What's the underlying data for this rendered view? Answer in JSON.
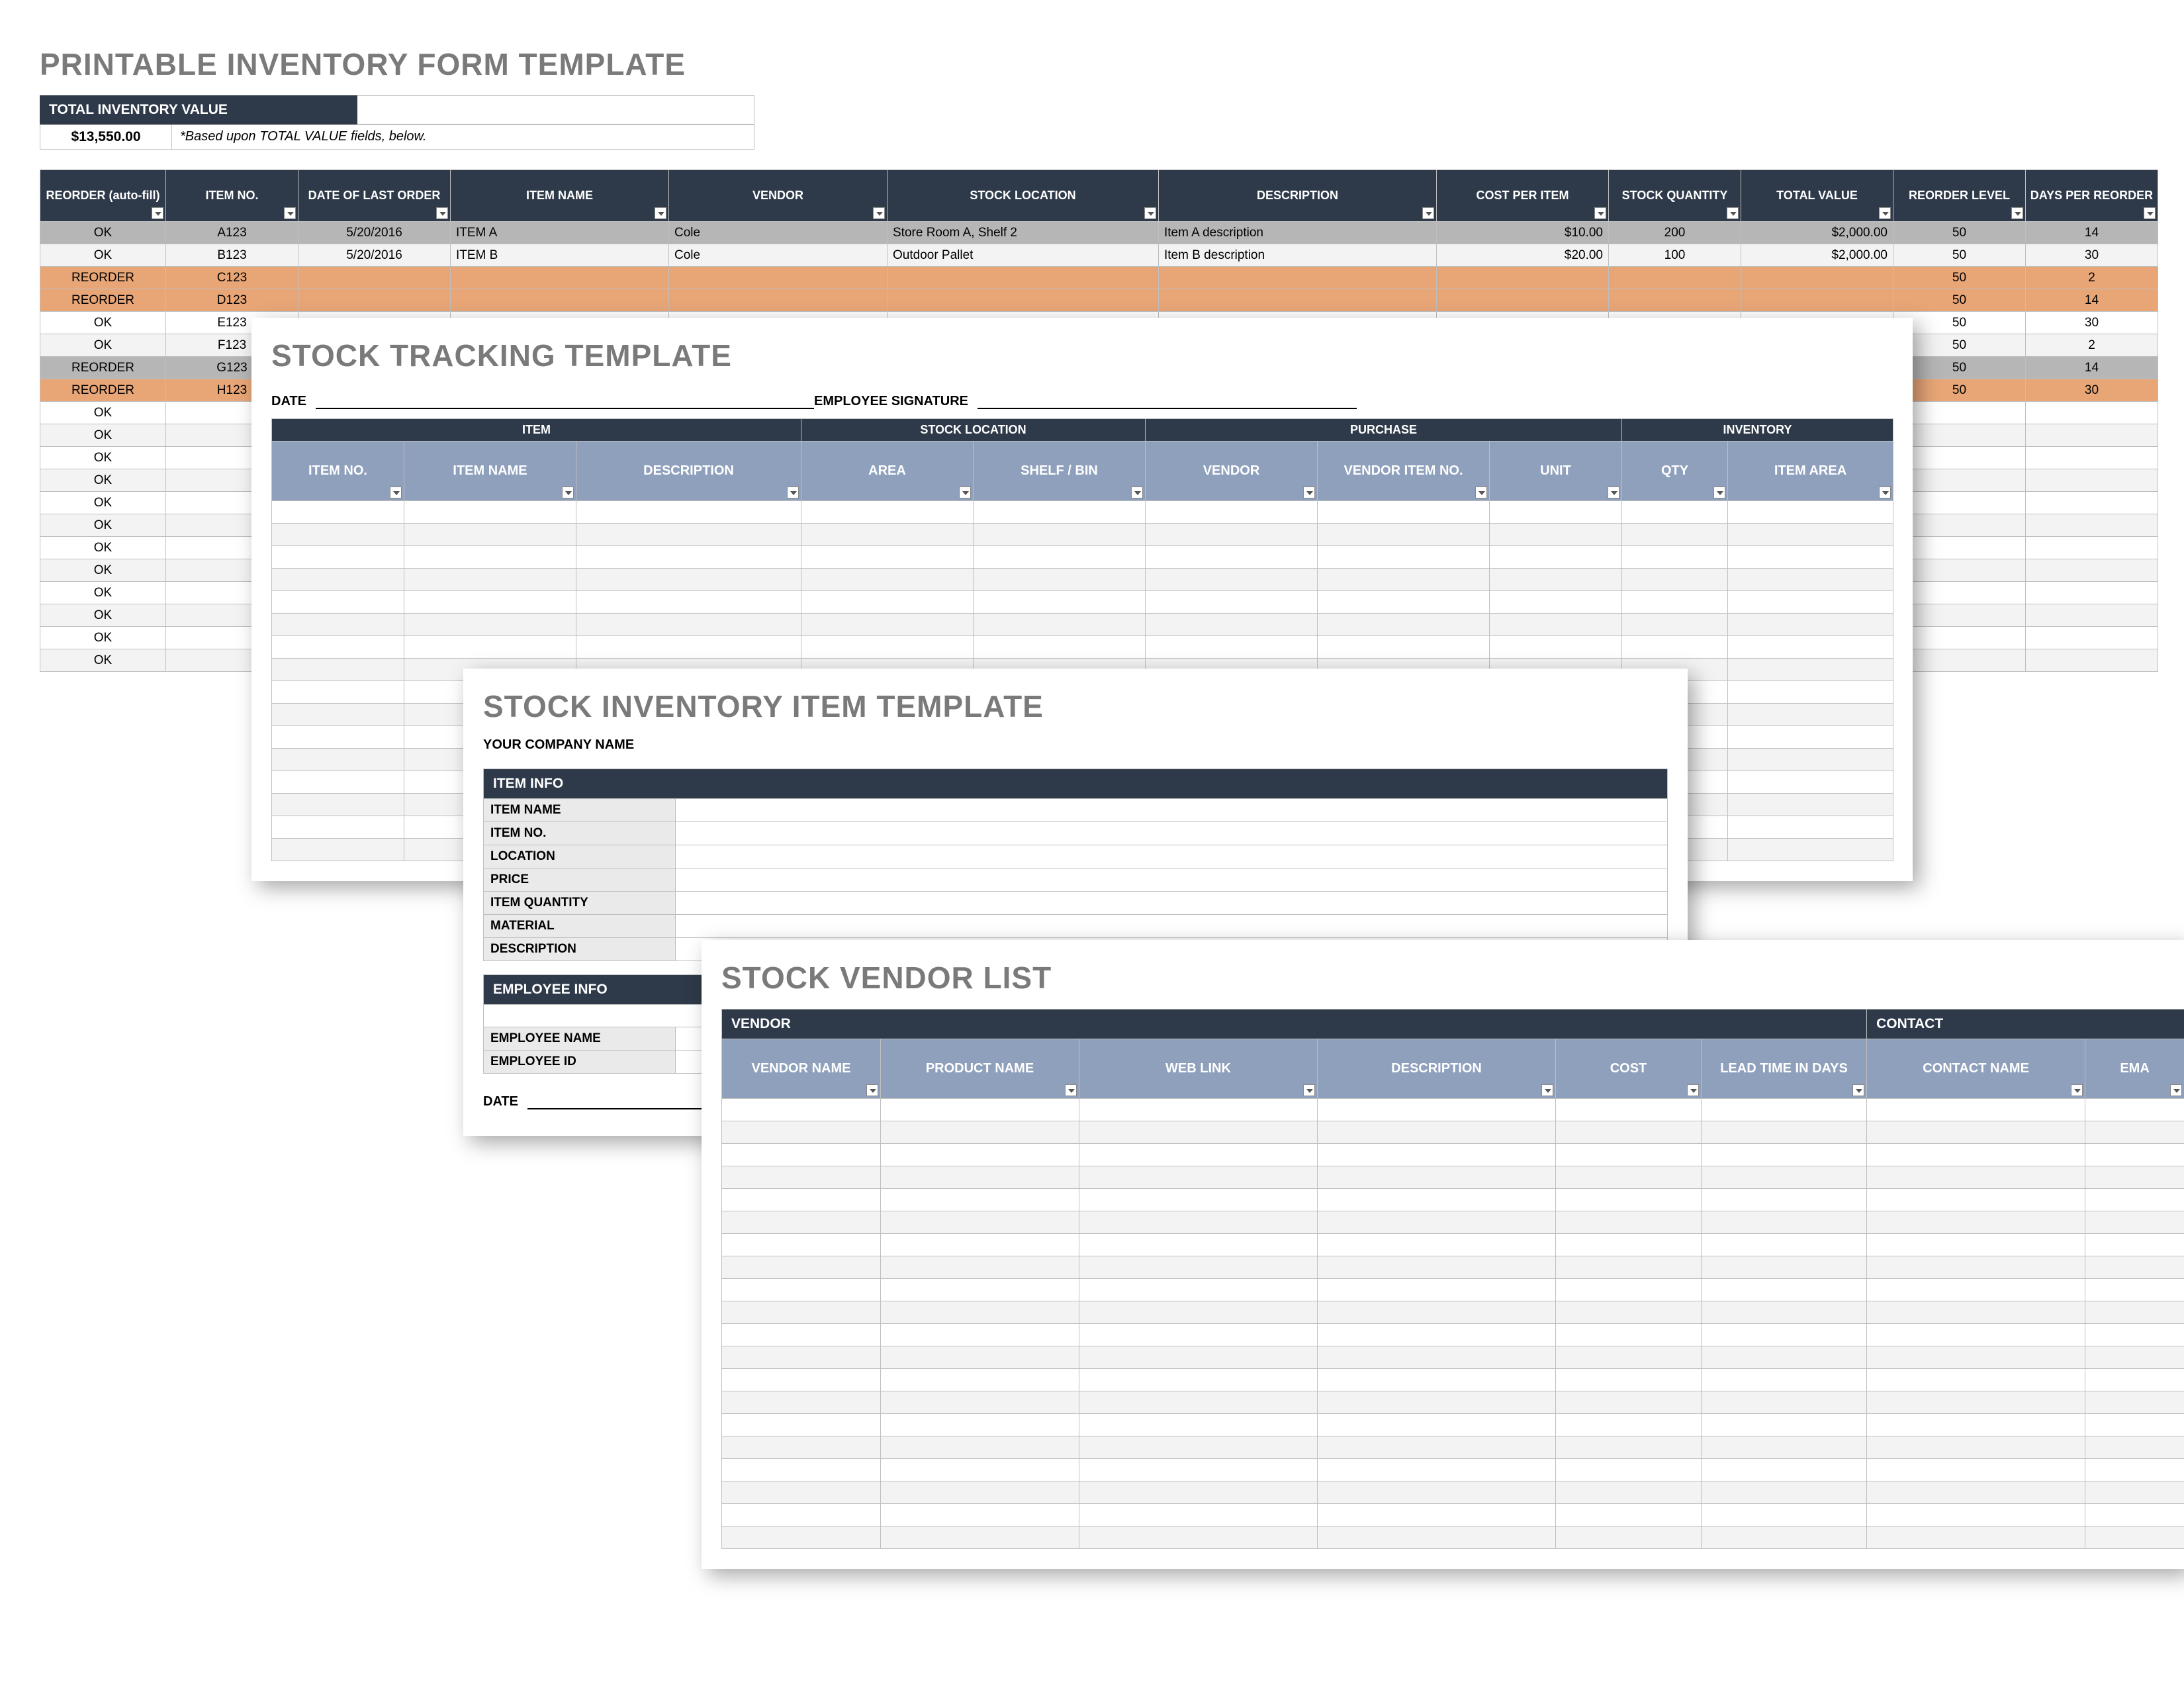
{
  "sheet1": {
    "title": "PRINTABLE INVENTORY FORM TEMPLATE",
    "total_label": "TOTAL INVENTORY VALUE",
    "total_value": "$13,550.00",
    "total_note": "*Based upon TOTAL VALUE fields, below.",
    "cols": [
      "REORDER (auto-fill)",
      "ITEM NO.",
      "DATE OF LAST ORDER",
      "ITEM NAME",
      "VENDOR",
      "STOCK LOCATION",
      "DESCRIPTION",
      "COST PER ITEM",
      "STOCK QUANTITY",
      "TOTAL VALUE",
      "REORDER LEVEL",
      "DAYS PER REORDER"
    ],
    "rows": [
      {
        "s": "grey",
        "c": [
          "OK",
          "A123",
          "5/20/2016",
          "ITEM A",
          "Cole",
          "Store Room A, Shelf 2",
          "Item A description",
          "$10.00",
          "200",
          "$2,000.00",
          "50",
          "14"
        ]
      },
      {
        "s": "",
        "c": [
          "OK",
          "B123",
          "5/20/2016",
          "ITEM B",
          "Cole",
          "Outdoor Pallet",
          "Item B description",
          "$20.00",
          "100",
          "$2,000.00",
          "50",
          "30"
        ]
      },
      {
        "s": "orange",
        "c": [
          "REORDER",
          "C123",
          "",
          "",
          "",
          "",
          "",
          "",
          "",
          "",
          "50",
          "2"
        ]
      },
      {
        "s": "orange",
        "c": [
          "REORDER",
          "D123",
          "",
          "",
          "",
          "",
          "",
          "",
          "",
          "",
          "50",
          "14"
        ]
      },
      {
        "s": "",
        "c": [
          "OK",
          "E123",
          "",
          "",
          "",
          "",
          "",
          "",
          "",
          "",
          "50",
          "30"
        ]
      },
      {
        "s": "",
        "c": [
          "OK",
          "F123",
          "",
          "",
          "",
          "",
          "",
          "",
          "",
          "",
          "50",
          "2"
        ]
      },
      {
        "s": "grey",
        "c": [
          "REORDER",
          "G123",
          "",
          "",
          "",
          "",
          "",
          "",
          "",
          "",
          "50",
          "14"
        ]
      },
      {
        "s": "orange",
        "c": [
          "REORDER",
          "H123",
          "",
          "",
          "",
          "",
          "",
          "",
          "",
          "",
          "50",
          "30"
        ]
      }
    ],
    "ok_fill_rows": 12
  },
  "sheet2": {
    "title": "STOCK TRACKING TEMPLATE",
    "date_label": "DATE",
    "sig_label": "EMPLOYEE SIGNATURE",
    "groups": [
      "ITEM",
      "STOCK LOCATION",
      "PURCHASE",
      "INVENTORY"
    ],
    "cols": [
      "ITEM NO.",
      "ITEM NAME",
      "DESCRIPTION",
      "AREA",
      "SHELF / BIN",
      "VENDOR",
      "VENDOR ITEM NO.",
      "UNIT",
      "QTY",
      "ITEM AREA"
    ],
    "blank_rows": 16
  },
  "sheet3": {
    "title": "STOCK INVENTORY ITEM TEMPLATE",
    "company_label": "YOUR COMPANY NAME",
    "item_info_hdr": "ITEM INFO",
    "item_fields": [
      "ITEM NAME",
      "ITEM NO.",
      "LOCATION",
      "PRICE",
      "ITEM QUANTITY",
      "MATERIAL",
      "DESCRIPTION"
    ],
    "emp_info_hdr": "EMPLOYEE INFO",
    "emp_fields": [
      "EMPLOYEE NAME",
      "EMPLOYEE ID"
    ],
    "date_label": "DATE"
  },
  "sheet4": {
    "title": "STOCK VENDOR LIST",
    "groups": [
      "VENDOR",
      "CONTACT"
    ],
    "cols": [
      "VENDOR NAME",
      "PRODUCT NAME",
      "WEB LINK",
      "DESCRIPTION",
      "COST",
      "LEAD TIME IN DAYS",
      "CONTACT NAME",
      "EMA"
    ],
    "blank_rows": 20
  }
}
